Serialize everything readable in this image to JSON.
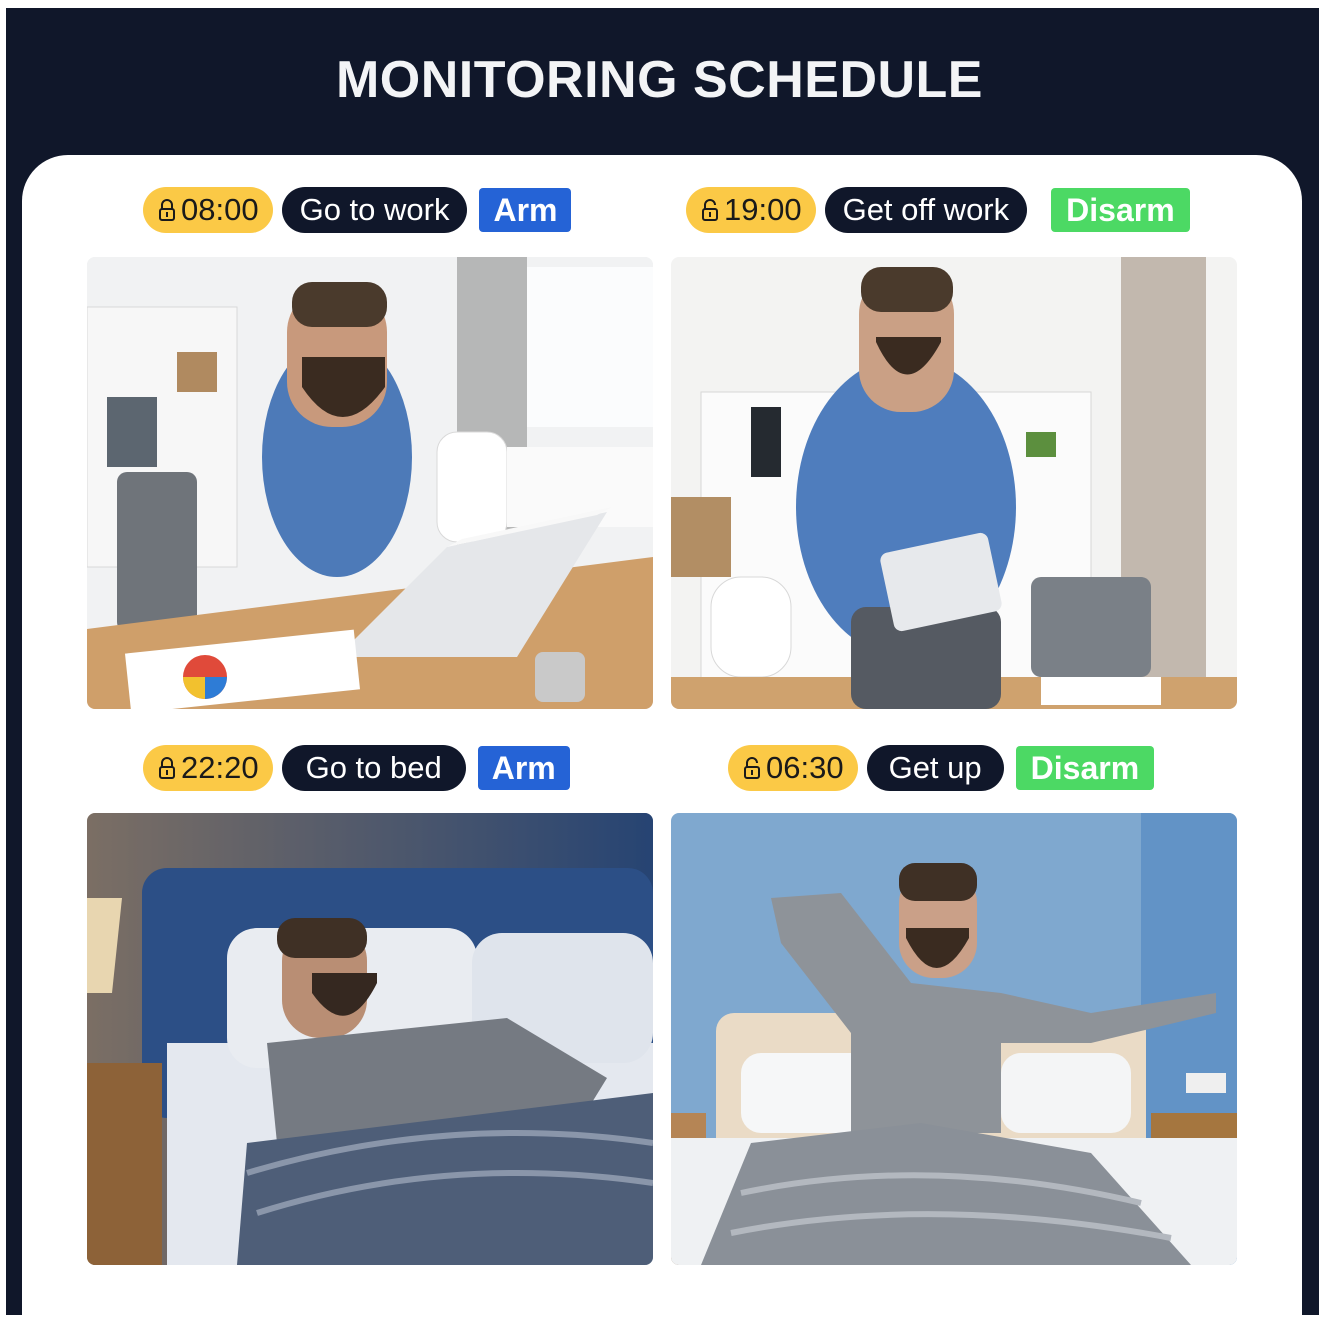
{
  "header": {
    "title": "MONITORING SCHEDULE"
  },
  "schedule": [
    {
      "time": "08:00",
      "lock": "locked-padlock-icon",
      "event": "Go to work",
      "mode": "Arm",
      "photo": "man working on laptop at office desk"
    },
    {
      "time": "19:00",
      "lock": "unlocked-padlock-icon",
      "event": "Get off work",
      "mode": "Disarm",
      "photo": "man packing laptop into bag in office"
    },
    {
      "time": "22:20",
      "lock": "locked-padlock-icon",
      "event": "Go to bed",
      "mode": "Arm",
      "photo": "man sleeping in bed"
    },
    {
      "time": "06:30",
      "lock": "unlocked-padlock-icon",
      "event": "Get up",
      "mode": "Disarm",
      "photo": "man stretching in bed after waking"
    }
  ],
  "colors": {
    "background": "#10172a",
    "time_pill": "#fbc946",
    "event_pill": "#10172a",
    "arm": "#2563d6",
    "disarm": "#4cd964"
  }
}
